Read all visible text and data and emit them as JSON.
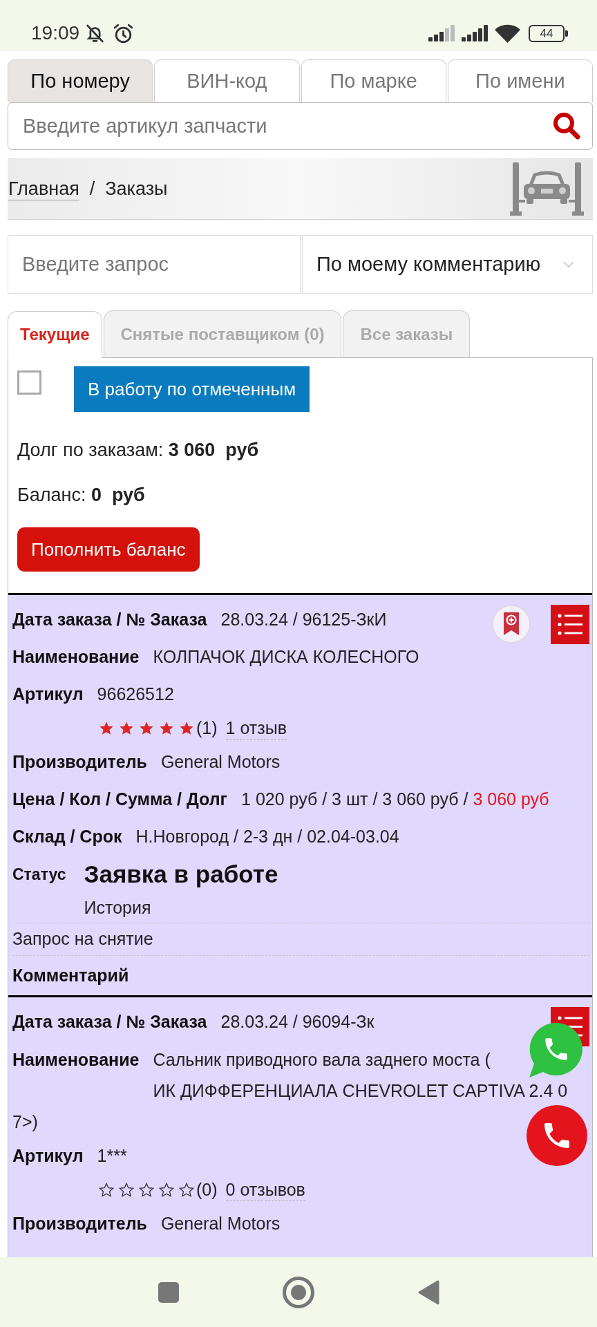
{
  "status_bar": {
    "time": "19:09",
    "battery": "44"
  },
  "search_tabs": [
    {
      "label": "По номеру",
      "selected": true
    },
    {
      "label": "ВИН-код",
      "selected": false
    },
    {
      "label": "По марке",
      "selected": false
    },
    {
      "label": "По имени",
      "selected": false
    }
  ],
  "search": {
    "placeholder": "Введите артикул запчасти"
  },
  "breadcrumbs": {
    "separator": "/",
    "items": [
      {
        "label": "Главная",
        "link": true
      },
      {
        "label": "Заказы",
        "link": false
      }
    ]
  },
  "filter": {
    "query_placeholder": "Введите запрос",
    "sort_value": "По моему комментарию"
  },
  "order_tabs": [
    {
      "label": "Текущие",
      "selected": true
    },
    {
      "label": "Снятые поставщиком (0)",
      "selected": false
    },
    {
      "label": "Все заказы",
      "selected": false
    }
  ],
  "bulk": {
    "checked": false,
    "button": "В работу по отмеченным"
  },
  "debt": "Долг по заказам: **3 060  руб**",
  "balance": "Баланс: **0  руб**",
  "top_up_button": "Пополнить баланс",
  "orders": [
    {
      "date_label": "Дата заказа / № Заказа",
      "date_value": "28.03.24 / 96125-ЗкИ",
      "bookmark_button": true,
      "fields": [
        {
          "kind": "text",
          "label": "Наименование",
          "value": "КОЛПАЧОК ДИСКА КОЛЕСНОГО"
        },
        {
          "kind": "text",
          "label": "Артикул",
          "value": "96626512"
        },
        {
          "kind": "rating",
          "stars": 5,
          "count": "(1)",
          "reviews": "1 отзыв"
        },
        {
          "kind": "text",
          "label": "Производитель",
          "value": "General Motors"
        },
        {
          "kind": "price",
          "label": "Цена / Кол / Сумма / Долг",
          "value": "1 020 руб / 3 шт / 3 060 руб /",
          "debt": "3 060 руб"
        },
        {
          "kind": "text",
          "label": "Склад / Срок",
          "value": "Н.Новгород / 2-3 дн / 02.04-03.04"
        },
        {
          "kind": "status",
          "label": "Статус",
          "value": "Заявка в работе",
          "link": "История"
        },
        {
          "kind": "note",
          "text": "Запрос на снятие"
        },
        {
          "kind": "heading",
          "text": "Комментарий"
        }
      ]
    },
    {
      "date_label": "Дата заказа / № Заказа",
      "date_value": "28.03.24 / 96094-Зк",
      "bookmark_button": false,
      "fields": [
        {
          "kind": "wrapped",
          "label": "Наименование",
          "lines": [
            "Сальник приводного вала заднего моста (",
            "ИК ДИФФЕРЕНЦИАЛА CHEVROLET CAPTIVA 2.4 0"
          ],
          "tail": "7>)"
        },
        {
          "kind": "text",
          "label": "Артикул",
          "value": "1***"
        },
        {
          "kind": "rating",
          "stars": 0,
          "count": "(0)",
          "reviews": "0 отзывов"
        },
        {
          "kind": "text",
          "label": "Производитель",
          "value": "General Motors"
        }
      ]
    }
  ]
}
